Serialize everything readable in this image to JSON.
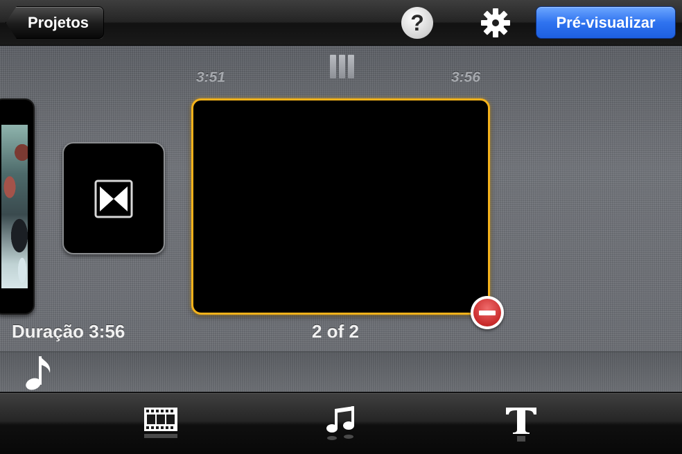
{
  "header": {
    "back_label": "Projetos",
    "help_label": "?",
    "settings_icon": "gear-icon",
    "preview_label": "Pré-visualizar"
  },
  "timeline": {
    "time_start": "3:51",
    "time_end": "3:56",
    "duration_label": "Duração 3:56",
    "position_label": "2 of 2",
    "transition_icon": "bowtie-transition-icon",
    "delete_icon": "minus-icon"
  },
  "music_track": {
    "icon": "music-note-icon"
  },
  "toolbar": {
    "items": [
      {
        "name": "video",
        "icon": "film-strip-icon"
      },
      {
        "name": "music",
        "icon": "music-notes-icon"
      },
      {
        "name": "title",
        "icon": "text-icon"
      }
    ]
  },
  "colors": {
    "accent_blue": "#2f73ef",
    "selection_yellow": "#f4b21b",
    "delete_red": "#c92b2b"
  }
}
